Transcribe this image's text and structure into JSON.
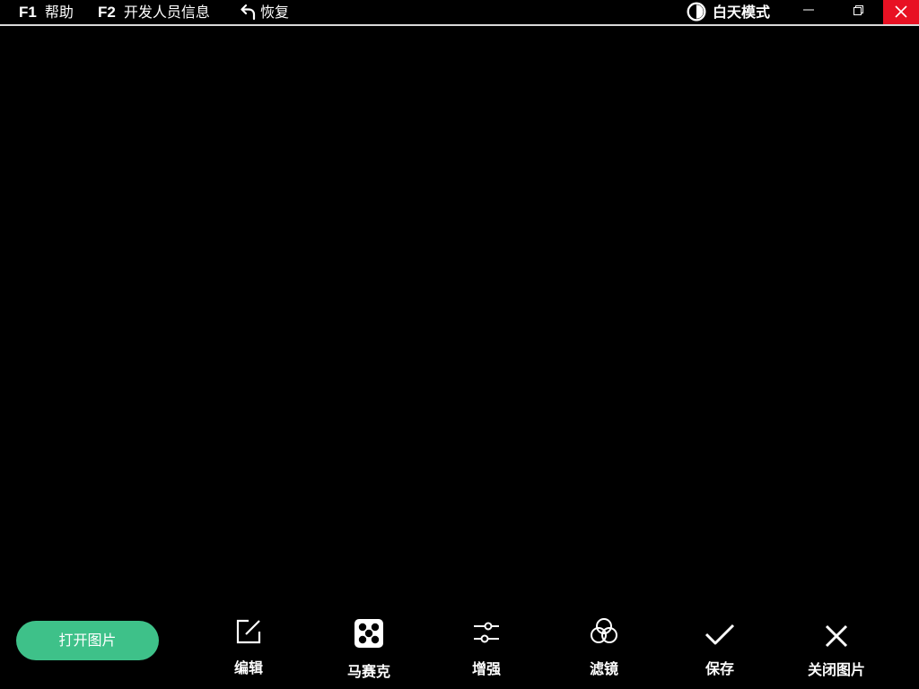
{
  "menu": {
    "help_key": "F1",
    "help_label": "帮助",
    "dev_key": "F2",
    "dev_label": "开发人员信息",
    "restore_label": "恢复"
  },
  "theme": {
    "label": "白天模式"
  },
  "window_controls": [
    "minimize",
    "restore",
    "close"
  ],
  "colors": {
    "accent": "#3ec189",
    "close_bg": "#e81123",
    "background": "#000000"
  },
  "toolbar": {
    "open_label": "打开图片",
    "tools": [
      {
        "label": "编辑",
        "icon": "edit-icon"
      },
      {
        "label": "马赛克",
        "icon": "mosaic-icon"
      },
      {
        "label": "增强",
        "icon": "sliders-icon"
      },
      {
        "label": "滤镜",
        "icon": "filter-icon"
      },
      {
        "label": "保存",
        "icon": "checkmark-icon"
      },
      {
        "label": "关闭图片",
        "icon": "close-image-icon"
      }
    ]
  }
}
